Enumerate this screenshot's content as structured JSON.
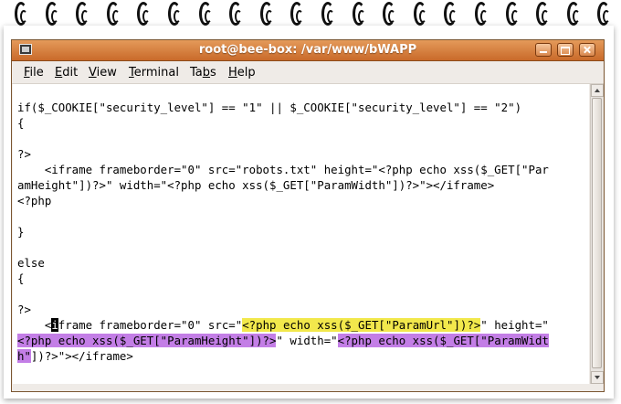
{
  "window": {
    "title": "root@bee-box: /var/www/bWAPP"
  },
  "menubar": {
    "items": [
      {
        "label": "File",
        "mnemonic": "F",
        "rest": "ile"
      },
      {
        "label": "Edit",
        "mnemonic": "E",
        "rest": "dit"
      },
      {
        "label": "View",
        "mnemonic": "V",
        "rest": "iew"
      },
      {
        "label": "Terminal",
        "mnemonic": "T",
        "rest": "erminal"
      },
      {
        "label": "Tabs",
        "pre": "Ta",
        "mnemonic": "b",
        "rest": "s"
      },
      {
        "label": "Help",
        "mnemonic": "H",
        "rest": "elp"
      }
    ]
  },
  "terminal": {
    "lines": [
      "if($_COOKIE[\"security_level\"] == \"1\" || $_COOKIE[\"security_level\"] == \"2\")",
      "{",
      "",
      "?>",
      "    <iframe frameborder=\"0\" src=\"robots.txt\" height=\"<?php echo xss($_GET[\"Par",
      "amHeight\"])?>\" width=\"<?php echo xss($_GET[\"ParamWidth\"])?>\"></iframe>",
      "<?php",
      "",
      "}",
      "",
      "else",
      "{",
      "",
      "?>"
    ],
    "highlighted": {
      "line15_a": "    <",
      "line15_cursor": "i",
      "line15_b": "frame frameborder=\"0\" src=\"",
      "line15_yellow": "<?php echo xss($_GET[\"ParamUrl\"])?>",
      "line15_c": "\" height=\"",
      "line16_purple": "<?php echo xss($_GET[\"ParamHeight\"])?>",
      "line16_b": "\" width=\"",
      "line16_purple2": "<?php echo xss($_GET[\"ParamWidt",
      "line17_purple": "h\"",
      "line17_b": "])?>\"></iframe>"
    }
  },
  "colors": {
    "titlebar": "#d9874c",
    "highlight_yellow": "#f2e84c",
    "highlight_purple": "#c37ee6"
  }
}
